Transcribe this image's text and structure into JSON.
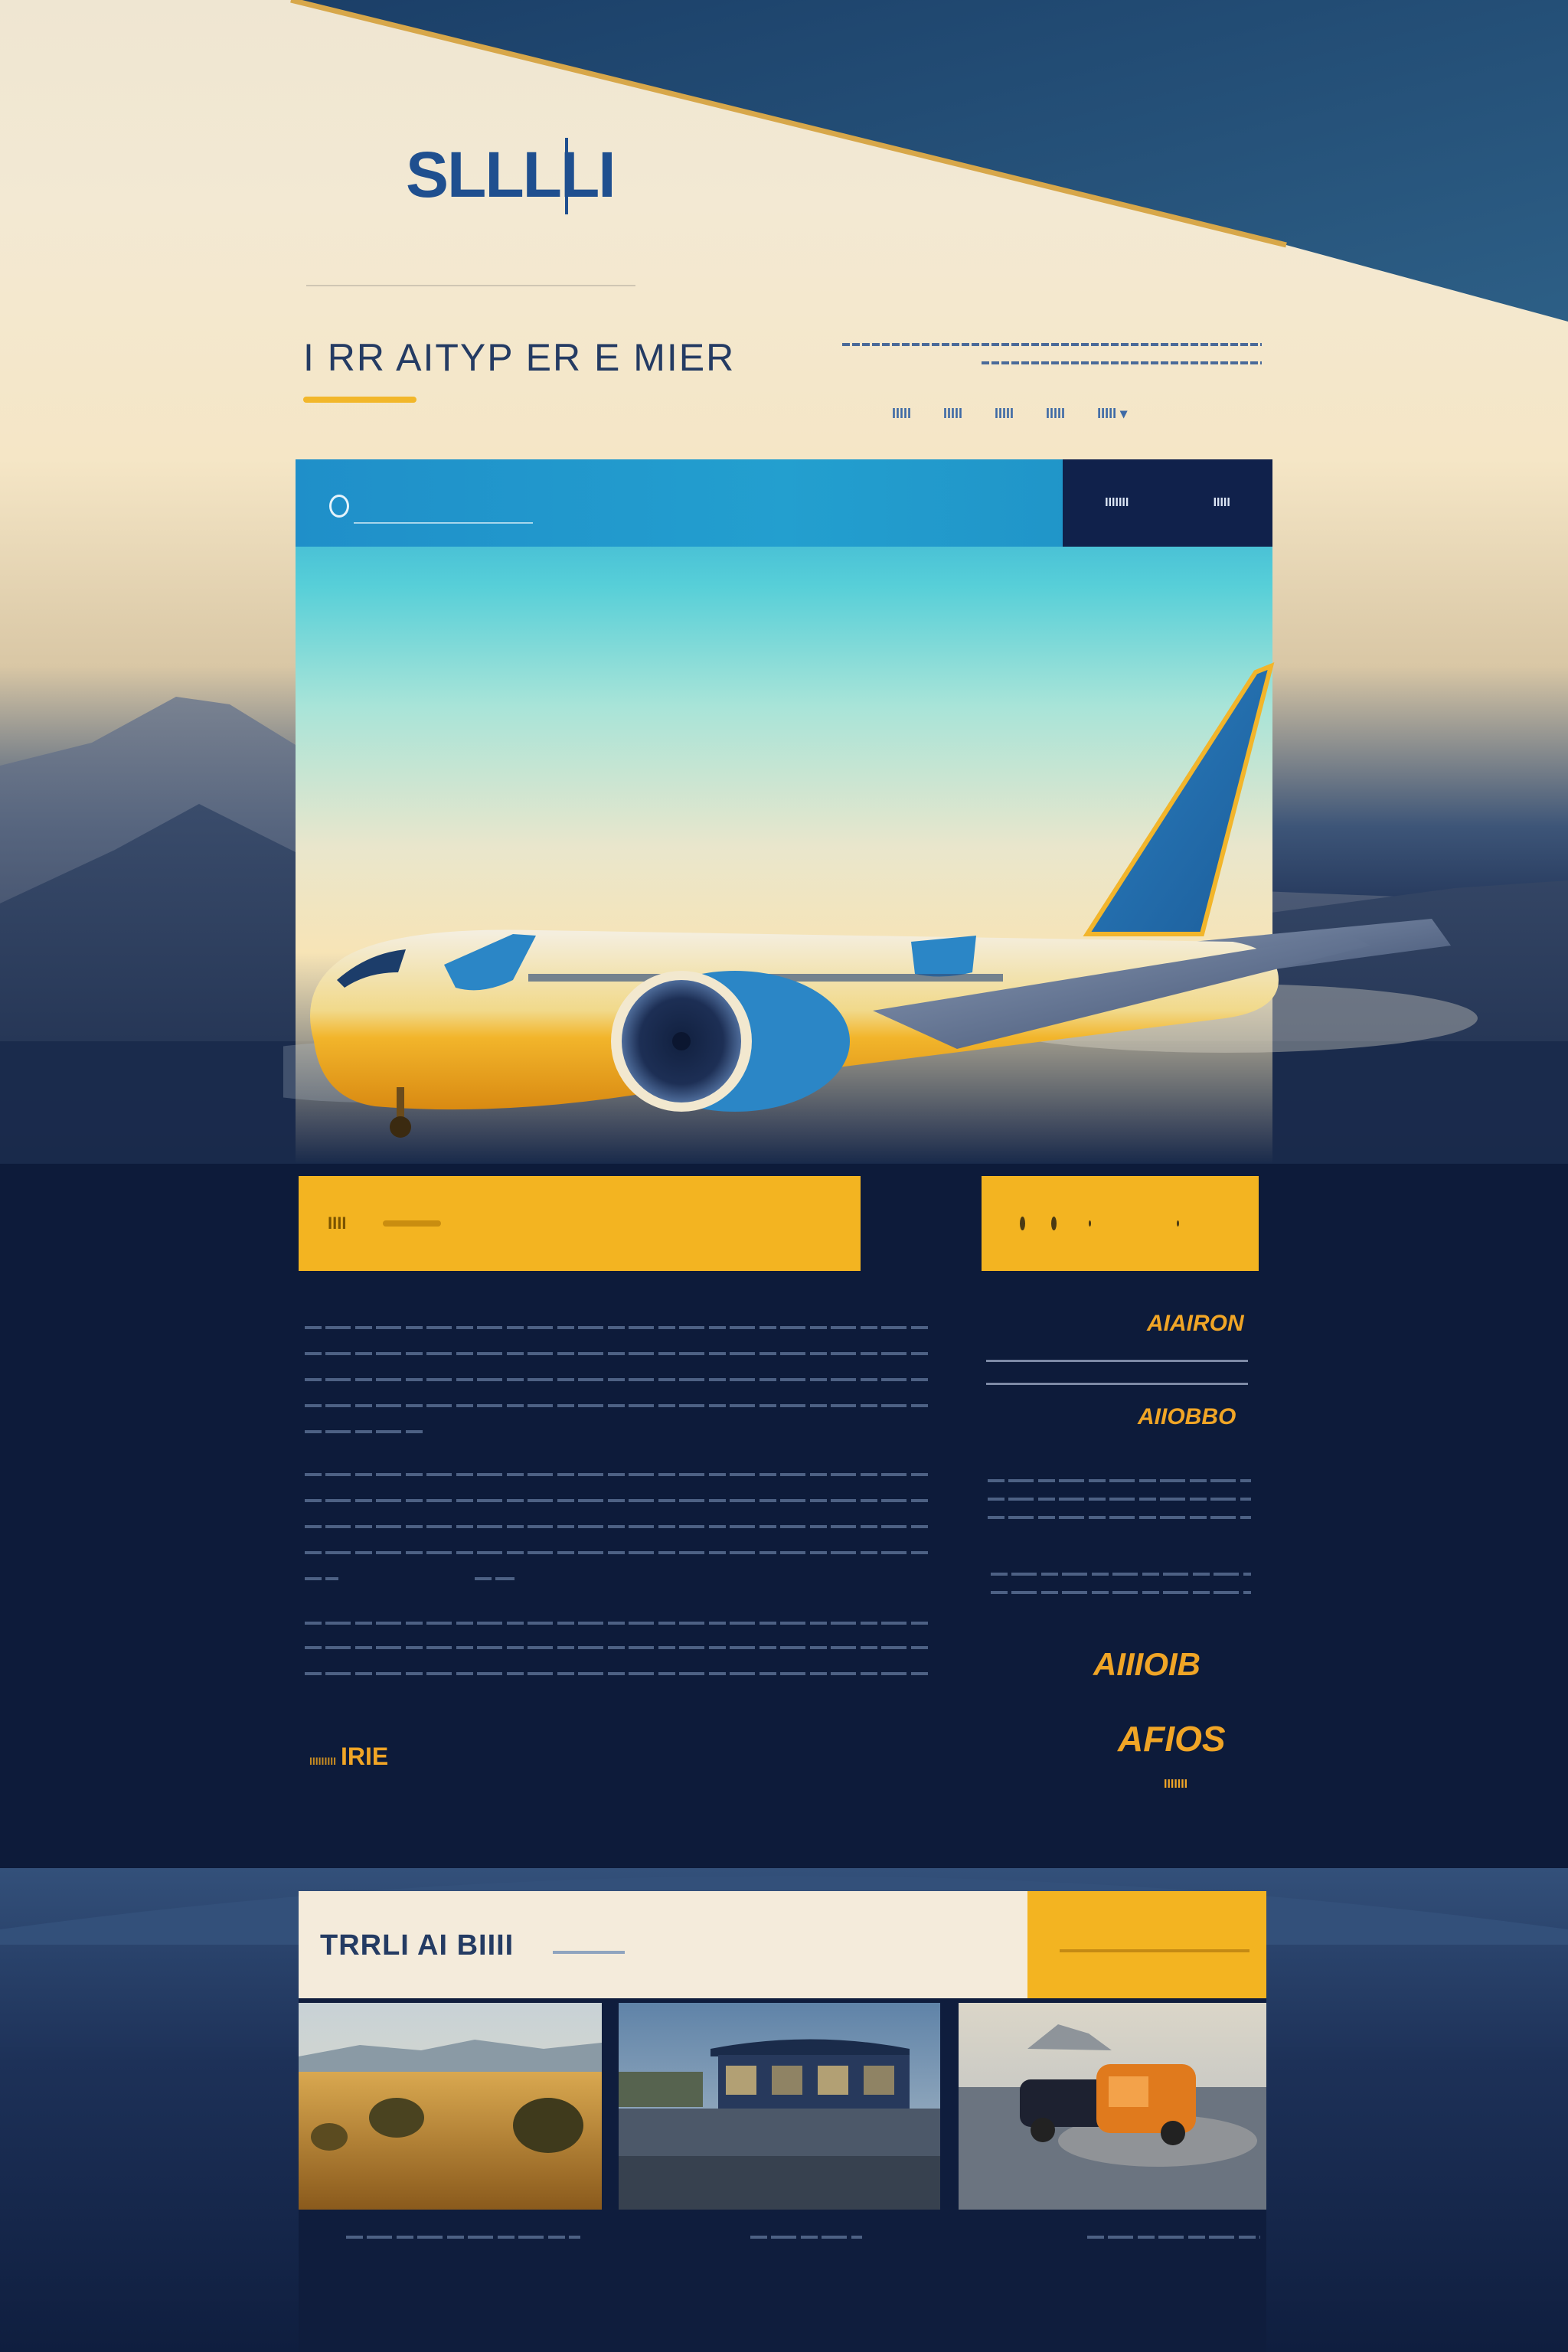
{
  "brand": {
    "logo": "SLLLLI",
    "tagline_left": "",
    "tagline_right": ""
  },
  "hero": {
    "title": "I RR AITYP ER E MIER",
    "subtext_1": "",
    "subtext_2": ""
  },
  "nav": {
    "items": [
      "IIIII",
      "IIIII",
      "IIIII",
      "IIIII",
      "IIIII ▾"
    ]
  },
  "search": {
    "placeholder": "",
    "links": [
      "",
      "",
      ""
    ],
    "actions": [
      "IIIIIII",
      "IIIII"
    ]
  },
  "cta": {
    "left_label": "IIII"
  },
  "content": {
    "paragraphs": []
  },
  "sidebar": {
    "title_1": "AIAIRON",
    "title_2": "AIIOBBO",
    "text_1": "",
    "text_2": "",
    "title_3": "AIIIOIB",
    "title_4": "AFIOS",
    "note": "IIIIIII"
  },
  "read_more": {
    "prefix": "IIIIIIIII",
    "label": "IRIE"
  },
  "gallery": {
    "title": "TRRLI AI BIIII",
    "captions": [
      "",
      "",
      ""
    ]
  },
  "colors": {
    "navy": "#0d1b3a",
    "accent_yellow": "#f3b421",
    "accent_orange": "#f0a526",
    "sky_blue": "#239fcf",
    "brand_blue": "#1f4f8f",
    "cream": "#f4ebdb"
  }
}
